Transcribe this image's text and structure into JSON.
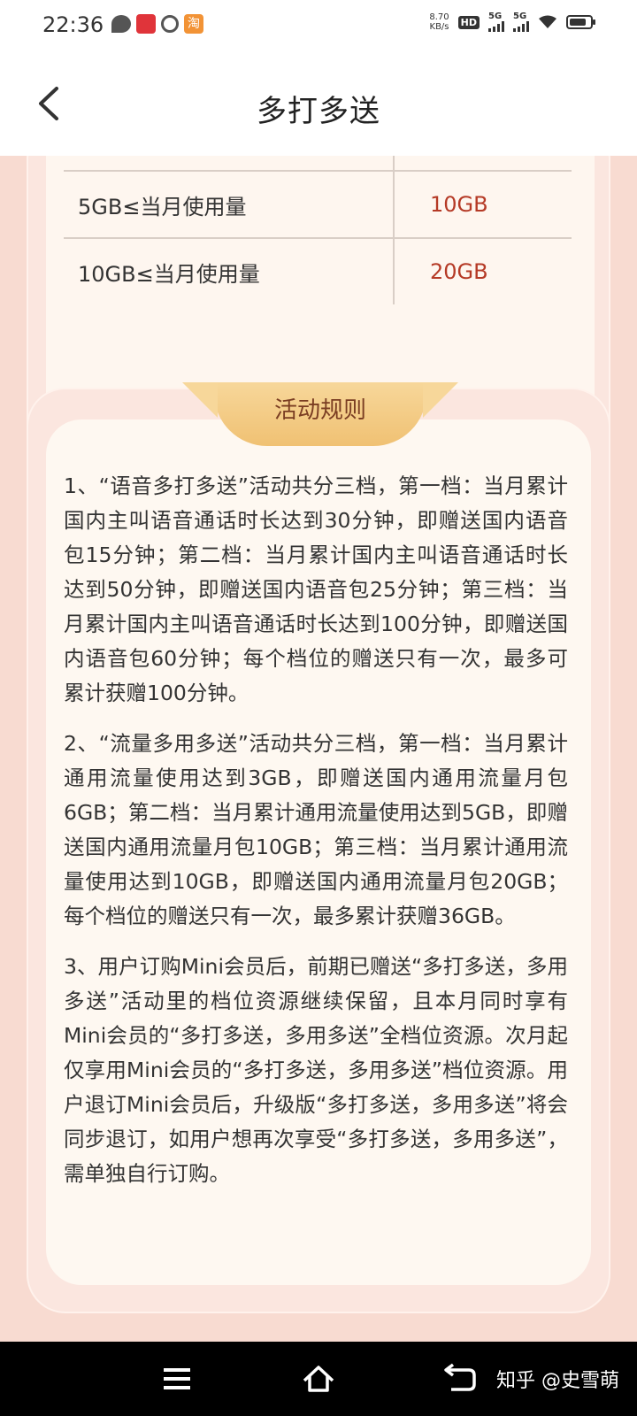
{
  "status_bar": {
    "time": "22:36",
    "net_speed_value": "8.70",
    "net_speed_unit": "KB/s",
    "hd_label": "HD",
    "sim1_label": "5G",
    "sim2_label": "5G",
    "taobao_char": "淘"
  },
  "header": {
    "title": "多打多送"
  },
  "tier_table": {
    "rows": [
      {
        "condition": "5GB≤当月使用量",
        "reward": "10GB"
      },
      {
        "condition": "10GB≤当月使用量",
        "reward": "20GB"
      }
    ]
  },
  "rules": {
    "heading": "活动规则",
    "items": [
      "1、“语音多打多送”活动共分三档，第一档：当月累计国内主叫语音通话时长达到30分钟，即赠送国内语音包15分钟；第二档：当月累计国内主叫语音通话时长达到50分钟，即赠送国内语音包25分钟；第三档：当月累计国内主叫语音通话时长达到100分钟，即赠送国内语音包60分钟；每个档位的赠送只有一次，最多可累计获赠100分钟。",
      "2、“流量多用多送”活动共分三档，第一档：当月累计通用流量使用达到3GB，即赠送国内通用流量月包6GB；第二档：当月累计通用流量使用达到5GB，即赠送国内通用流量月包10GB；第三档：当月累计通用流量使用达到10GB，即赠送国内通用流量月包20GB；每个档位的赠送只有一次，最多累计获赠36GB。",
      "3、用户订购Mini会员后，前期已赠送“多打多送，多用多送”活动里的档位资源继续保留，且本月同时享有Mini会员的“多打多送，多用多送”全档位资源。次月起仅享用Mini会员的“多打多送，多用多送”档位资源。用户退订Mini会员后，升级版“多打多送，多用多送”将会同步退订，如用户想再次享受“多打多送，多用多送”，需单独自行订购。"
    ]
  },
  "watermark": "知乎 @史雪萌",
  "colors": {
    "page_bg": "#f8dbd1",
    "reward_text": "#b53a26",
    "tab_gold": "#f0c173"
  }
}
